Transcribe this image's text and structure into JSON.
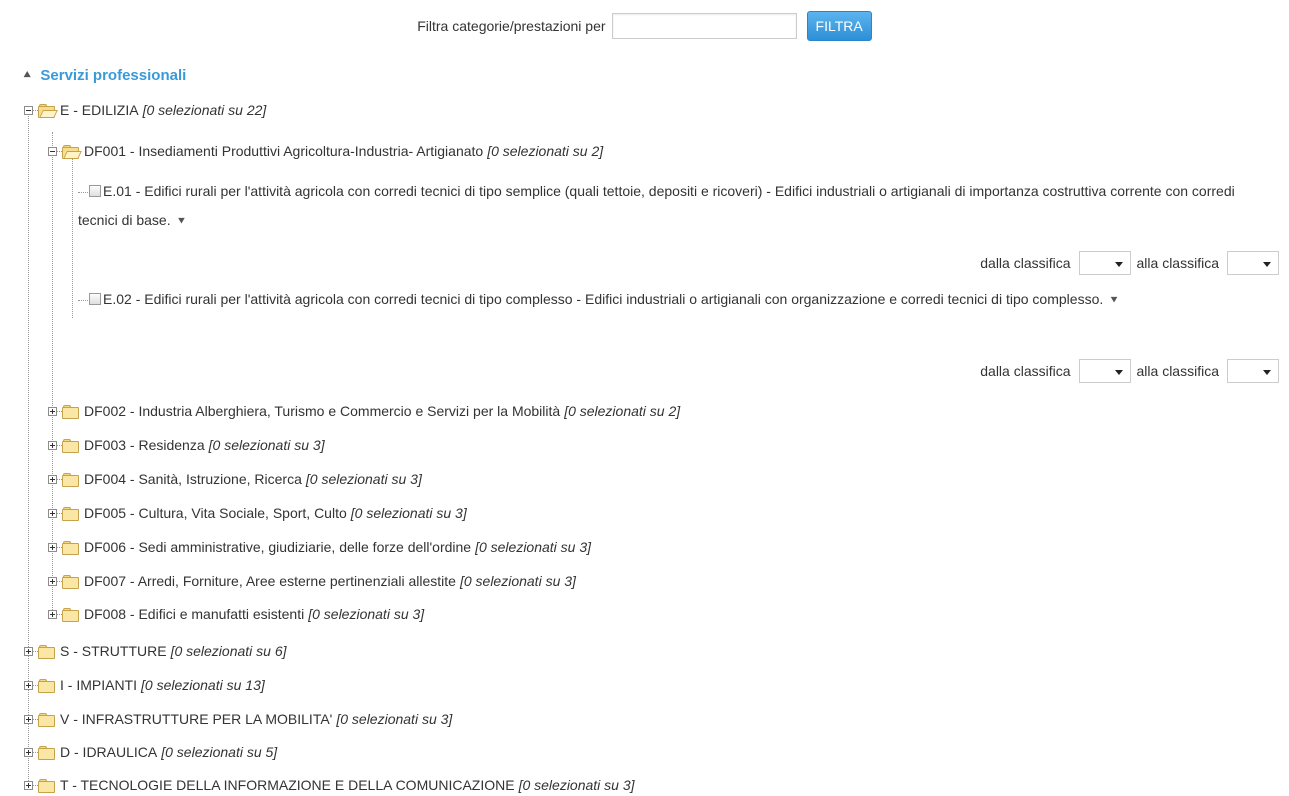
{
  "filter": {
    "label": "Filtra categorie/prestazioni per",
    "input_value": "",
    "button_label": "FILTRA"
  },
  "section": {
    "label": "Servizi professionali"
  },
  "tree": {
    "edilizia": {
      "label": "E - EDILIZIA",
      "count": "[0 selezionati su 22]"
    },
    "df001": {
      "label": "DF001 - Insediamenti Produttivi Agricoltura-Industria- Artigianato",
      "count": "[0 selezionati su 2]"
    },
    "items": [
      {
        "code_text": "E.01 - Edifici rurali per l'attività agricola con corredi tecnici di tipo semplice (quali tettoie, depositi e ricoveri) - Edifici industriali o artigianali di importanza costruttiva corrente con corredi tecnici di base.",
        "from_label": "dalla classifica",
        "to_label": "alla classifica"
      },
      {
        "code_text": "E.02 - Edifici rurali per l'attività agricola con corredi tecnici di tipo complesso - Edifici industriali o artigianali con organizzazione e corredi tecnici di tipo complesso.",
        "from_label": "dalla classifica",
        "to_label": "alla classifica"
      }
    ],
    "subfolders": [
      {
        "label": "DF002 - Industria Alberghiera, Turismo e Commercio e Servizi per la Mobilità",
        "count": "[0 selezionati su 2]"
      },
      {
        "label": "DF003 - Residenza",
        "count": "[0 selezionati su 3]"
      },
      {
        "label": "DF004 - Sanità, Istruzione, Ricerca",
        "count": "[0 selezionati su 3]"
      },
      {
        "label": "DF005 - Cultura, Vita Sociale, Sport, Culto",
        "count": "[0 selezionati su 3]"
      },
      {
        "label": "DF006 - Sedi amministrative, giudiziarie, delle forze dell'ordine",
        "count": "[0 selezionati su 3]"
      },
      {
        "label": "DF007 - Arredi, Forniture, Aree esterne pertinenziali allestite",
        "count": "[0 selezionati su 3]"
      },
      {
        "label": "DF008 - Edifici e manufatti esistenti",
        "count": "[0 selezionati su 3]"
      }
    ],
    "categories": [
      {
        "label": "S - STRUTTURE",
        "count": "[0 selezionati su 6]"
      },
      {
        "label": "I - IMPIANTI",
        "count": "[0 selezionati su 13]"
      },
      {
        "label": "V - INFRASTRUTTURE PER LA MOBILITA'",
        "count": "[0 selezionati su 3]"
      },
      {
        "label": "D - IDRAULICA",
        "count": "[0 selezionati su 5]"
      },
      {
        "label": "T - TECNOLOGIE DELLA INFORMAZIONE E DELLA COMUNICAZIONE",
        "count": "[0 selezionati su 3]"
      }
    ]
  },
  "icons": {
    "collapse_section": "double-chevron-up-icon",
    "expand_description": "double-chevron-down-icon",
    "tree_toggle": "plus-minus-box-icon",
    "folder": "folder-icon"
  },
  "colors": {
    "accent_link": "#3a9ad9",
    "button": "#2d8fd6",
    "folder": "#fbe7a5"
  }
}
